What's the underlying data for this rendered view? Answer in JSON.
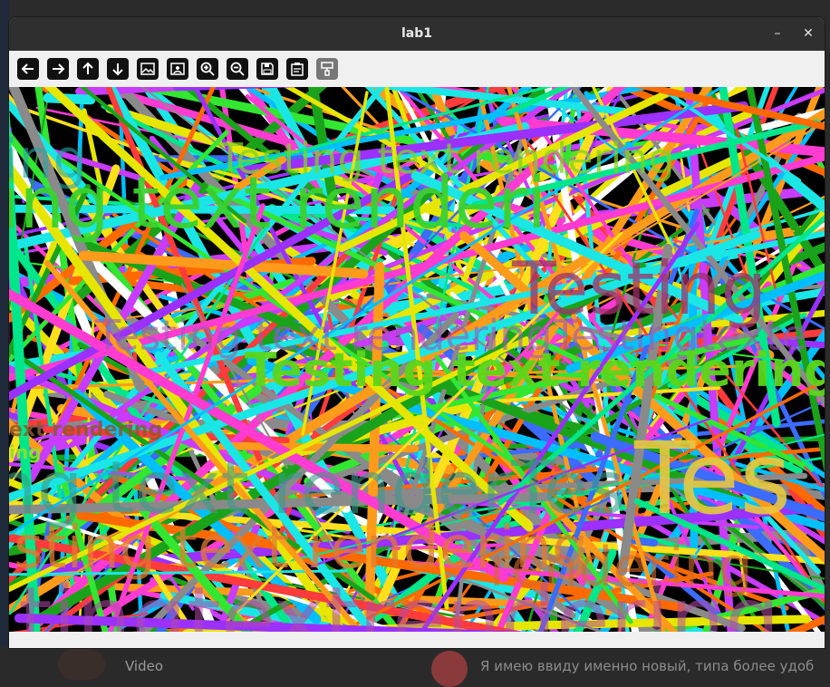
{
  "window": {
    "title": "lab1",
    "minimize_glyph": "–",
    "close_glyph": "✕"
  },
  "toolbar": {
    "buttons": [
      {
        "name": "back-icon",
        "enabled": true
      },
      {
        "name": "forward-icon",
        "enabled": true
      },
      {
        "name": "arrow-up-icon",
        "enabled": true
      },
      {
        "name": "arrow-down-icon",
        "enabled": true
      },
      {
        "name": "image-icon",
        "enabled": true
      },
      {
        "name": "image-edit-icon",
        "enabled": true
      },
      {
        "name": "zoom-in-icon",
        "enabled": true
      },
      {
        "name": "zoom-out-icon",
        "enabled": true
      },
      {
        "name": "save-icon",
        "enabled": true
      },
      {
        "name": "clipboard-icon",
        "enabled": true
      },
      {
        "name": "paint-brush-icon",
        "enabled": false
      }
    ]
  },
  "canvas": {
    "texts": [
      {
        "text": "Testing text rendering",
        "color": "#7ed321"
      },
      {
        "text": "ing text renderi",
        "color": "#3ad12e"
      },
      {
        "text": "ting",
        "color": "#2aa5a0"
      },
      {
        "text": "Testing",
        "color": "#a0306a"
      },
      {
        "text": "Testing text renderingTestingtexte",
        "color": "#9b59b6"
      },
      {
        "text": "Testing text rendering",
        "color": "#5bd61a"
      },
      {
        "text": "ext rendering",
        "color": "#8b5a2b"
      },
      {
        "text": "ing",
        "color": "#8be02e"
      },
      {
        "text": "ng text renderTes",
        "color": "#3a9a8a"
      },
      {
        "text": "Tes",
        "color": "#e8c840"
      },
      {
        "text": "sting text rendering",
        "color": "#e07a30"
      },
      {
        "text": "rendering",
        "color": "#d06a2a"
      },
      {
        "text": "tingtextrendering",
        "color": "#b04aa8"
      }
    ],
    "palette": [
      "#ff3b3b",
      "#ff9b1a",
      "#ffe01a",
      "#32e632",
      "#1ae6e6",
      "#3b6bff",
      "#c83bff",
      "#ff3bd2",
      "#8a8a8a",
      "#ffffff",
      "#1aa31a",
      "#ff6a00",
      "#00bfff",
      "#9b30ff",
      "#e6e600",
      "#00e68a"
    ]
  },
  "background": {
    "video_label": "Video",
    "chat_preview": "Я имею ввиду именно новый, типа более удоб"
  }
}
